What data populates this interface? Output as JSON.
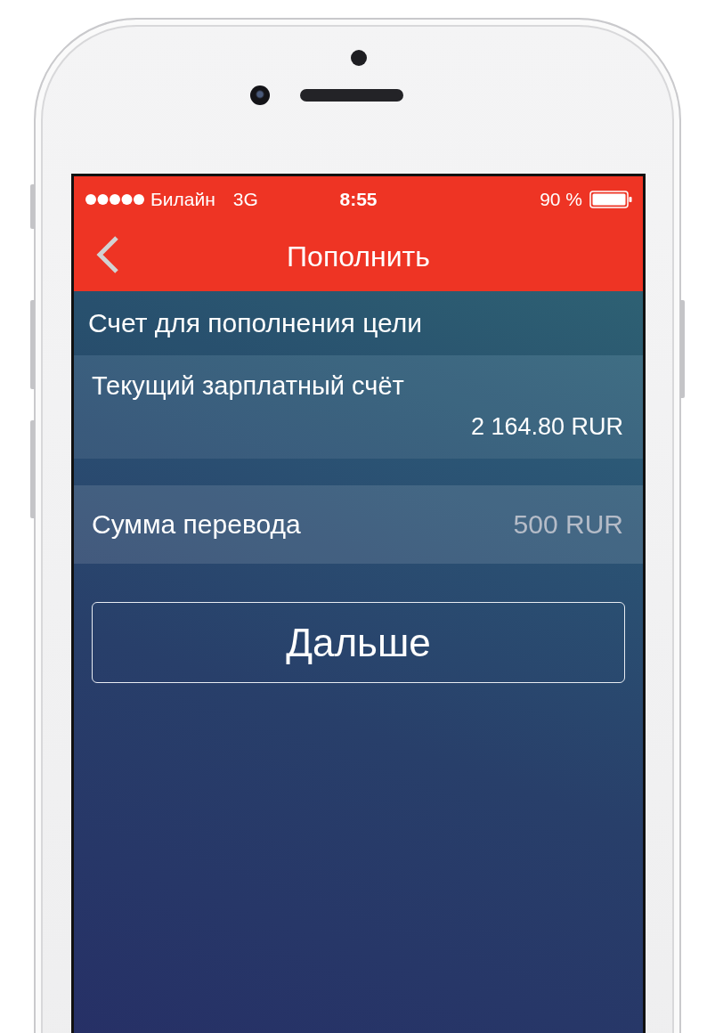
{
  "status_bar": {
    "carrier": "Билайн",
    "network": "3G",
    "time": "8:55",
    "battery": "90 %"
  },
  "nav": {
    "title": "Пополнить"
  },
  "section_header": "Счет для пополнения цели",
  "account": {
    "name": "Текущий зарплатный счёт",
    "balance": "2 164.80 RUR"
  },
  "amount": {
    "label": "Сумма перевода",
    "placeholder": "500 RUR"
  },
  "next_button": "Дальше"
}
